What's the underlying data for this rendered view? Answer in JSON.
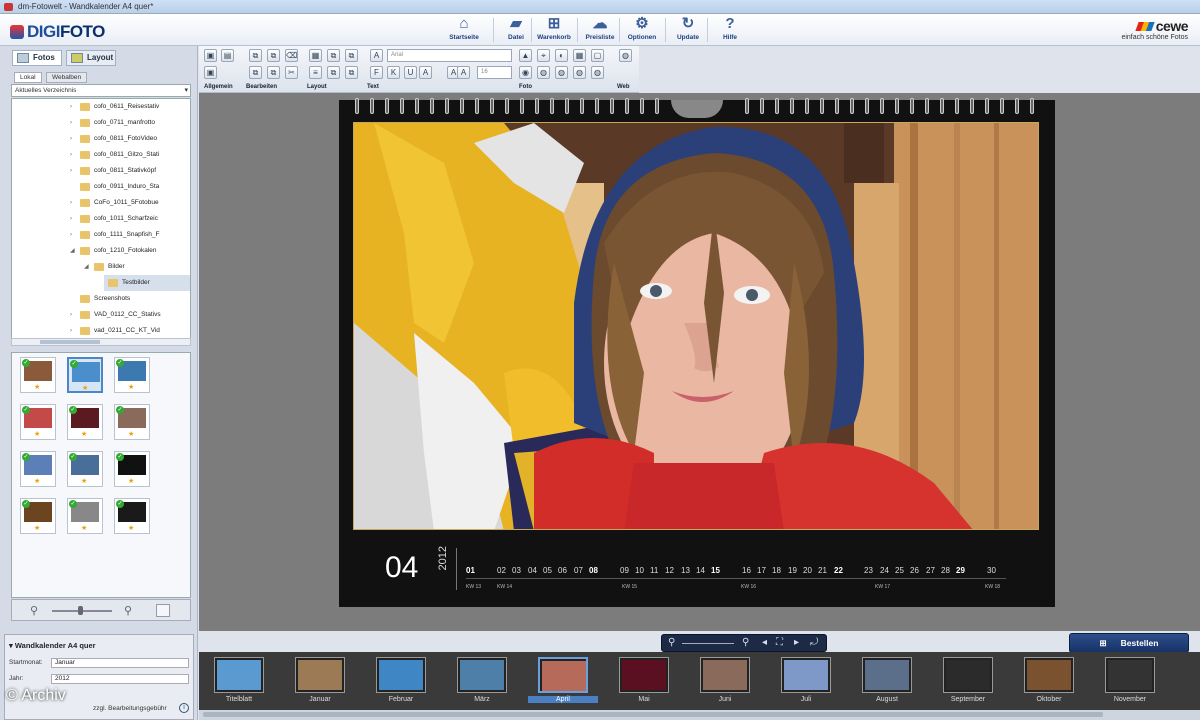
{
  "window": {
    "title": "dm-Fotowelt - Wandkalender A4 quer*"
  },
  "app": {
    "logo_prefix": "DIGI",
    "logo_suffix": "FOTO"
  },
  "nav": [
    {
      "label": "Startseite",
      "icon": "home-icon",
      "glyph": "⌂"
    },
    {
      "label": "Datei",
      "icon": "folder-icon",
      "glyph": "▰"
    },
    {
      "label": "Warenkorb",
      "icon": "cart-icon",
      "glyph": "⊞"
    },
    {
      "label": "Preisliste",
      "icon": "cloud-icon",
      "glyph": "☁"
    },
    {
      "label": "Optionen",
      "icon": "gear-icon",
      "glyph": "⚙"
    },
    {
      "label": "Update",
      "icon": "refresh-icon",
      "glyph": "↻"
    },
    {
      "label": "Hilfe",
      "icon": "help-icon",
      "glyph": "?"
    }
  ],
  "brand": {
    "name": "cewe",
    "slogan": "einfach schöne Fotos"
  },
  "tabs": {
    "fotos": "Fotos",
    "layout": "Layout"
  },
  "subtabs": {
    "lokal": "Lokal",
    "webalben": "Webalben"
  },
  "directory": {
    "selected": "Aktuelles Verzeichnis"
  },
  "tree": [
    {
      "label": "cofo_0611_Reisestativ",
      "indent": 2,
      "expand": "›"
    },
    {
      "label": "cofo_0711_manfrotto",
      "indent": 2,
      "expand": "›"
    },
    {
      "label": "cofo_0811_FotoVideo",
      "indent": 2,
      "expand": "›"
    },
    {
      "label": "cofo_0811_Gitzo_Stati",
      "indent": 2,
      "expand": "›"
    },
    {
      "label": "cofo_0811_Stativköpf",
      "indent": 2,
      "expand": "›"
    },
    {
      "label": "cofo_0911_Induro_Sta",
      "indent": 2,
      "expand": ""
    },
    {
      "label": "CoFo_1011_5Fotobue",
      "indent": 2,
      "expand": "›"
    },
    {
      "label": "cofo_1011_Scharfzeic",
      "indent": 2,
      "expand": "›"
    },
    {
      "label": "cofo_1111_Snapfish_F",
      "indent": 2,
      "expand": "›"
    },
    {
      "label": "cofo_1210_Fotokalen",
      "indent": 2,
      "expand": "◢"
    },
    {
      "label": "Bilder",
      "indent": 3,
      "expand": "◢"
    },
    {
      "label": "Testbilder",
      "indent": 4,
      "expand": "",
      "selected": true
    },
    {
      "label": "Screenshots",
      "indent": 2,
      "expand": ""
    },
    {
      "label": "VAD_0112_CC_Stativs",
      "indent": 2,
      "expand": "›"
    },
    {
      "label": "vad_0211_CC_KT_Vid",
      "indent": 2,
      "expand": "›"
    }
  ],
  "toolbar": {
    "groups": [
      "Allgemein",
      "Bearbeiten",
      "Layout",
      "Text",
      "Foto",
      "Web"
    ],
    "font": "Arial",
    "size": "16"
  },
  "calendar": {
    "month": "04",
    "year": "2012",
    "days": [
      "01",
      "02",
      "03",
      "04",
      "05",
      "06",
      "07",
      "08",
      "09",
      "10",
      "11",
      "12",
      "13",
      "14",
      "15",
      "16",
      "17",
      "18",
      "19",
      "20",
      "21",
      "22",
      "23",
      "24",
      "25",
      "26",
      "27",
      "28",
      "29",
      "30"
    ],
    "bold_days": [
      "01",
      "08",
      "15",
      "22",
      "29"
    ],
    "weeks": [
      "KW 13",
      "KW 14",
      "KW 15",
      "KW 16",
      "KW 17",
      "KW 18"
    ]
  },
  "order_button": "Bestellen",
  "props": {
    "title": "Wandkalender A4 quer",
    "start_label": "Startmonat:",
    "start_value": "Januar",
    "year_label": "Jahr:",
    "year_value": "2012",
    "fee": "zzgl. Bearbeitungsgebühr"
  },
  "filmstrip": [
    {
      "label": "Titelblatt",
      "c": "#5a9ad1"
    },
    {
      "label": "Januar",
      "c": "#9b7a55"
    },
    {
      "label": "Februar",
      "c": "#3f86c4"
    },
    {
      "label": "März",
      "c": "#4e7fa9"
    },
    {
      "label": "April",
      "c": "#b56a5a",
      "selected": true
    },
    {
      "label": "Mai",
      "c": "#5a1020"
    },
    {
      "label": "Juni",
      "c": "#8a6a5a"
    },
    {
      "label": "Juli",
      "c": "#7e98c8"
    },
    {
      "label": "August",
      "c": "#5b6e8a"
    },
    {
      "label": "September",
      "c": "#2b2b2b"
    },
    {
      "label": "Oktober",
      "c": "#7a5230"
    },
    {
      "label": "November",
      "c": "#333333"
    }
  ],
  "watermark": "© Archiv",
  "colors": {
    "accent": "#173266",
    "header_blue": "#1f4f9c"
  }
}
